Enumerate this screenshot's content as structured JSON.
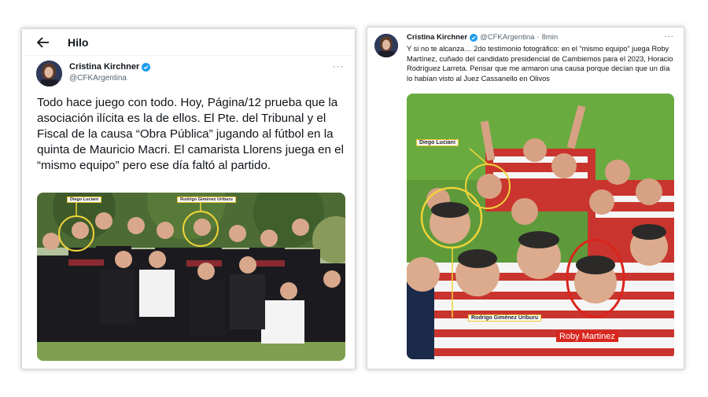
{
  "left_tweet": {
    "header_title": "Hilo",
    "author_name": "Cristina Kirchner",
    "author_handle": "@CFKArgentina",
    "more": "···",
    "text": "Todo hace juego con todo. Hoy, Página/12 prueba que la asociación ilícita es la de ellos. El Pte. del Tribunal y el Fiscal de la causa “Obra Pública” jugando al fútbol en la quinta de Mauricio Macri. El camarista Llorens juega en el “mismo equipo” pero ese día faltó al partido.",
    "photo_labels": {
      "person_a": "Diego Luciani",
      "person_b": "Rodrigo Giménez Uriburu"
    }
  },
  "right_tweet": {
    "author_name": "Cristina Kirchner",
    "author_handle": "@CFKArgentina",
    "separator": "·",
    "time": "8min",
    "more": "···",
    "text": "Y si no te alcanza… 2do testimonio fotográfico: en el “mismo equipo” juega Roby Martínez, cuñado del candidato presidencial de Cambiemos para el 2023, Horacio Rodríguez Larreta. Pensar que me armaron una causa porque decían que un día lo habían visto al Juez Cassanello en Olivos",
    "photo_labels": {
      "person_a": "Diego Luciani",
      "person_b": "Rodrigo Giménez Uriburu",
      "person_c": "Roby Martinez"
    }
  },
  "colors": {
    "verified": "#1d9bf0",
    "highlight_yellow": "#f0d43a",
    "highlight_red": "#d9251d",
    "text_primary": "#0f1419",
    "text_secondary": "#536471"
  },
  "icons": {
    "back": "arrow-left-icon",
    "verified": "verified-badge-icon",
    "more": "more-horizontal-icon"
  }
}
